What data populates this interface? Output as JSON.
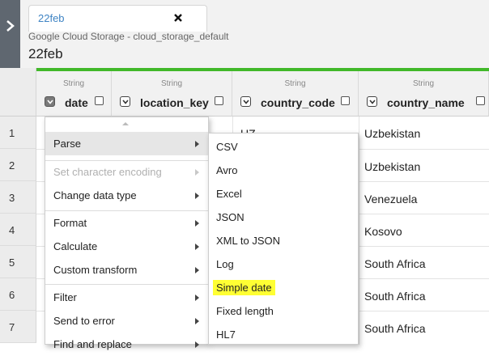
{
  "tab": {
    "label": "22feb"
  },
  "header": {
    "subtitle": "Google Cloud Storage  - cloud_storage_default",
    "title": "22feb"
  },
  "columns": [
    {
      "type": "String",
      "name": "date"
    },
    {
      "type": "String",
      "name": "location_key"
    },
    {
      "type": "String",
      "name": "country_code"
    },
    {
      "type": "String",
      "name": "country_name"
    }
  ],
  "rows": [
    {
      "num": "1",
      "country_code": "UZ",
      "country_name": "Uzbekistan"
    },
    {
      "num": "2",
      "country_code": "",
      "country_name": "Uzbekistan"
    },
    {
      "num": "3",
      "country_code": "",
      "country_name": "Venezuela"
    },
    {
      "num": "4",
      "country_code": "",
      "country_name": "Kosovo"
    },
    {
      "num": "5",
      "country_code": "",
      "country_name": "South Africa"
    },
    {
      "num": "6",
      "country_code": "",
      "country_name": "South Africa"
    },
    {
      "num": "7",
      "country_code": "",
      "country_name": "South Africa"
    }
  ],
  "menu": {
    "items": [
      {
        "label": "Parse",
        "highlighted": true
      },
      {
        "label": "Set character encoding",
        "disabled": true
      },
      {
        "label": "Change data type"
      },
      {
        "label": "Format"
      },
      {
        "label": "Calculate"
      },
      {
        "label": "Custom transform"
      },
      {
        "label": "Filter"
      },
      {
        "label": "Send to error"
      },
      {
        "label": "Find and replace"
      }
    ]
  },
  "submenu": {
    "items": [
      {
        "label": "CSV"
      },
      {
        "label": "Avro"
      },
      {
        "label": "Excel"
      },
      {
        "label": "JSON"
      },
      {
        "label": "XML to JSON"
      },
      {
        "label": "Log"
      },
      {
        "label": "Simple date",
        "highlighted": true
      },
      {
        "label": "Fixed length"
      },
      {
        "label": "HL7"
      }
    ]
  },
  "colors": {
    "accent_green": "#41b829",
    "highlight_yellow": "#ffff33",
    "tab_text": "#3f84c4"
  }
}
